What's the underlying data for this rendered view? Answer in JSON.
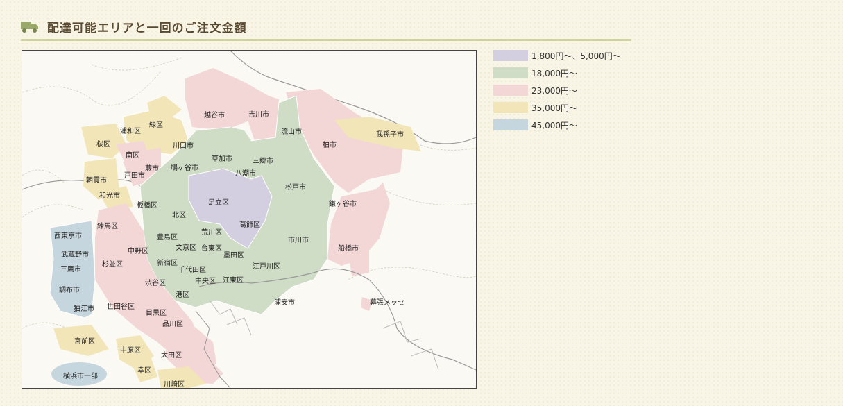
{
  "header": {
    "title": "配達可能エリアと一回のご注文金額",
    "icon": "truck-icon"
  },
  "legend": [
    {
      "label": "1,800円〜、5,000円〜",
      "color": "#d3cfe0"
    },
    {
      "label": "18,000円〜",
      "color": "#cfdcc6"
    },
    {
      "label": "23,000円〜",
      "color": "#f3d6d6"
    },
    {
      "label": "35,000円〜",
      "color": "#f2e6b9"
    },
    {
      "label": "45,000円〜",
      "color": "#c6d6de"
    }
  ],
  "map": {
    "labels": {
      "koshigaya": "越谷市",
      "yoshikawa": "吉川市",
      "nagareyama": "流山市",
      "abiko": "我孫子市",
      "kashiwa": "柏市",
      "misato": "三郷市",
      "yashio": "八潮市",
      "soka": "草加市",
      "kawaguchi": "川口市",
      "hatogaya": "鳩ヶ谷市",
      "warabi": "蕨市",
      "toda": "戸田市",
      "minami": "南区",
      "urawa": "浦和区",
      "midori": "緑区",
      "sakura": "桜区",
      "asaka": "朝霞市",
      "wako": "和光市",
      "itabashi": "板橋区",
      "kita": "北区",
      "adachi": "足立区",
      "katsushika": "葛飾区",
      "matsudo": "松戸市",
      "kamagaya": "鎌ヶ谷市",
      "funabashi": "船橋市",
      "ichikawa": "市川市",
      "edogawa": "江戸川区",
      "urayasu": "浦安市",
      "arakawa": "荒川区",
      "taito": "台東区",
      "sumida": "墨田区",
      "koto": "江東区",
      "chuo": "中央区",
      "chiyoda": "千代田区",
      "bunkyo": "文京区",
      "toshima": "豊島区",
      "nerima": "練馬区",
      "nishitokyo": "西東京市",
      "musashino": "武蔵野市",
      "mitaka": "三鷹市",
      "chofu": "調布市",
      "komae": "狛江市",
      "suginami": "杉並区",
      "nakano": "中野区",
      "shinjuku": "新宿区",
      "shibuya": "渋谷区",
      "minato": "港区",
      "setagaya": "世田谷区",
      "meguro": "目黒区",
      "shinagawa": "品川区",
      "ota": "大田区",
      "miyamae": "宮前区",
      "nakahara": "中原区",
      "saiwai": "幸区",
      "kawasaki": "川崎区",
      "yokohama": "横浜市一部",
      "makuhari": "幕張メッセ"
    }
  }
}
